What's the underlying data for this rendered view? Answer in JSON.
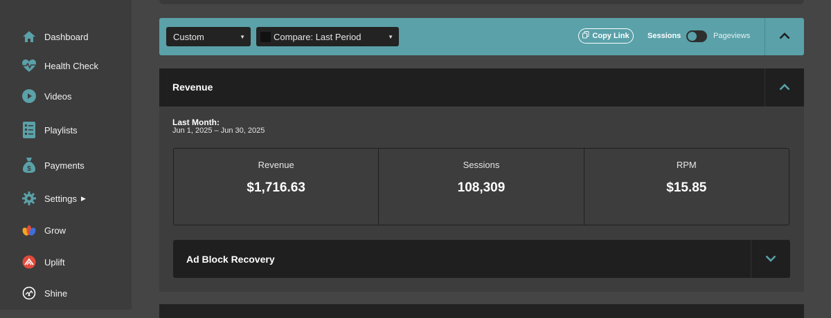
{
  "sidebar": {
    "items": [
      {
        "label": "Dashboard",
        "icon": "home-icon"
      },
      {
        "label": "Health Check",
        "icon": "heartbeat-icon"
      },
      {
        "label": "Videos",
        "icon": "play-circle-icon"
      },
      {
        "label": "Playlists",
        "icon": "list-icon"
      },
      {
        "label": "Payments",
        "icon": "money-bag-icon"
      },
      {
        "label": "Settings",
        "icon": "gear-icon"
      },
      {
        "label": "Grow",
        "icon": "grow-logo-icon"
      },
      {
        "label": "Uplift",
        "icon": "uplift-logo-icon"
      },
      {
        "label": "Shine",
        "icon": "shine-logo-icon"
      }
    ]
  },
  "toolbar": {
    "date_select": "Custom",
    "compare_select": "Compare: Last Period",
    "copy_link": "Copy Link",
    "toggle_left": "Sessions",
    "toggle_right": "Pageviews"
  },
  "revenue_panel": {
    "title": "Revenue",
    "period_label": "Last Month:",
    "period_range": "Jun 1, 2025 – Jun 30, 2025",
    "stats": [
      {
        "label": "Revenue",
        "value": "$1,716.63"
      },
      {
        "label": "Sessions",
        "value": "108,309"
      },
      {
        "label": "RPM",
        "value": "$15.85"
      }
    ]
  },
  "ad_block": {
    "title": "Ad Block Recovery"
  },
  "colors": {
    "accent": "#5aa1a9",
    "sidebar_bg": "#3c3c3c",
    "panel_header": "#1f1f1f"
  }
}
